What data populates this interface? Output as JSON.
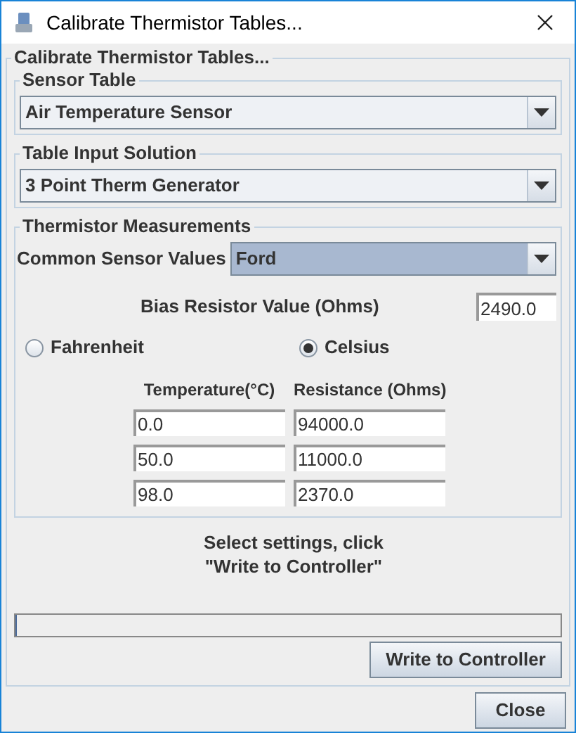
{
  "window": {
    "title": "Calibrate Thermistor Tables..."
  },
  "panel": {
    "title": "Calibrate Thermistor Tables...",
    "sensor_table": {
      "title": "Sensor Table",
      "value": "Air Temperature Sensor"
    },
    "table_input_solution": {
      "title": "Table Input Solution",
      "value": "3 Point Therm Generator"
    },
    "thermistor_measurements": {
      "title": "Thermistor Measurements",
      "common_sensor_values": {
        "label": "Common Sensor Values",
        "value": "Ford"
      },
      "bias_resistor": {
        "label": "Bias Resistor Value (Ohms)",
        "value": "2490.0"
      },
      "units": [
        {
          "label": "Fahrenheit",
          "selected": false
        },
        {
          "label": "Celsius",
          "selected": true
        }
      ],
      "columns": [
        "Temperature(°C)",
        "Resistance (Ohms)"
      ],
      "rows": [
        [
          "0.0",
          "94000.0"
        ],
        [
          "50.0",
          "11000.0"
        ],
        [
          "98.0",
          "2370.0"
        ]
      ]
    },
    "message": [
      "Select settings, click",
      "\"Write to Controller\""
    ],
    "progress": {
      "level": 0
    },
    "write_button": "Write to Controller"
  },
  "close_button": "Close"
}
